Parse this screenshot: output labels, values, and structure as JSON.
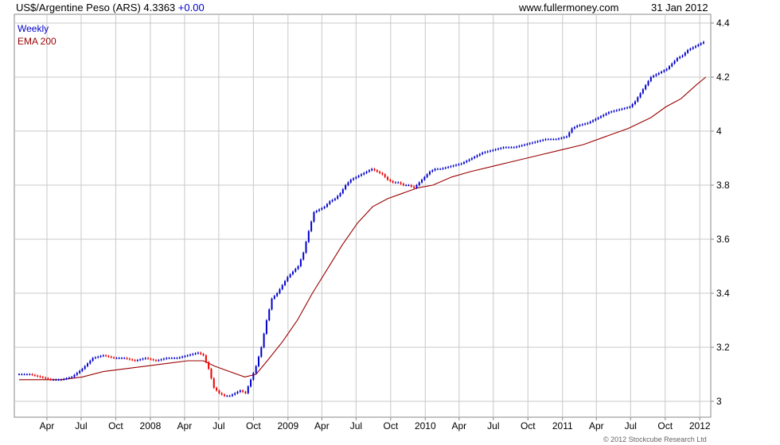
{
  "header": {
    "title": "US$/Argentine Peso (ARS) 4.3363",
    "change": "+0.00",
    "site": "www.fullermoney.com",
    "date": "31 Jan 2012"
  },
  "copyright": "© 2012 Stockcube Research Ltd",
  "colors": {
    "up": "#0000cc",
    "down": "#ee0000",
    "ema": "#990000",
    "grid": "#c8c8c8",
    "frame": "#888888"
  },
  "chart_data": {
    "type": "candlestick-line",
    "frequency": "Weekly",
    "legend": [
      {
        "name": "Weekly",
        "color": "#0000cc"
      },
      {
        "name": "EMA 200",
        "color": "#990000"
      }
    ],
    "legend_position": "top-left",
    "grid": true,
    "ylim": [
      2.95,
      4.42
    ],
    "y_ticks": [
      3,
      3.2,
      3.4,
      3.6,
      3.8,
      4,
      4.2,
      4.4
    ],
    "y_tick_labels": [
      "3",
      "3.2",
      "3.4",
      "3.6",
      "3.8",
      "4",
      "4.2",
      "4.4"
    ],
    "xlim": [
      0,
      1090
    ],
    "x_ticks": [
      {
        "label": "Apr",
        "day": 74
      },
      {
        "label": "Jul",
        "day": 165
      },
      {
        "label": "Oct",
        "day": 257
      },
      {
        "label": "2008",
        "day": 349
      },
      {
        "label": "Apr",
        "day": 440
      },
      {
        "label": "Jul",
        "day": 531
      },
      {
        "label": "Oct",
        "day": 623
      },
      {
        "label": "2009",
        "day": 715
      },
      {
        "label": "Apr",
        "day": 805
      },
      {
        "label": "Jul",
        "day": 896
      },
      {
        "label": "Oct",
        "day": 988
      },
      {
        "label": "2010",
        "day": 1080
      }
    ],
    "x_ticks_late": [
      {
        "label": "Apr",
        "day": 1170
      },
      {
        "label": "Jul",
        "day": 1261
      },
      {
        "label": "Oct",
        "day": 1353
      },
      {
        "label": "2011",
        "day": 1445
      },
      {
        "label": "Apr",
        "day": 1535
      },
      {
        "label": "Jul",
        "day": 1626
      },
      {
        "label": "Oct",
        "day": 1718
      },
      {
        "label": "2012",
        "day": 1810
      }
    ],
    "price_keypoints": [
      [
        0,
        3.1
      ],
      [
        28,
        3.1
      ],
      [
        56,
        3.09
      ],
      [
        84,
        3.08
      ],
      [
        112,
        3.08
      ],
      [
        140,
        3.09
      ],
      [
        168,
        3.12
      ],
      [
        196,
        3.16
      ],
      [
        224,
        3.17
      ],
      [
        252,
        3.16
      ],
      [
        280,
        3.16
      ],
      [
        308,
        3.15
      ],
      [
        336,
        3.16
      ],
      [
        364,
        3.15
      ],
      [
        392,
        3.16
      ],
      [
        420,
        3.16
      ],
      [
        448,
        3.17
      ],
      [
        476,
        3.18
      ],
      [
        490,
        3.17
      ],
      [
        504,
        3.12
      ],
      [
        518,
        3.05
      ],
      [
        532,
        3.03
      ],
      [
        546,
        3.02
      ],
      [
        560,
        3.02
      ],
      [
        574,
        3.03
      ],
      [
        588,
        3.04
      ],
      [
        602,
        3.03
      ],
      [
        616,
        3.08
      ],
      [
        630,
        3.13
      ],
      [
        644,
        3.2
      ],
      [
        658,
        3.3
      ],
      [
        672,
        3.38
      ],
      [
        686,
        3.4
      ],
      [
        700,
        3.43
      ],
      [
        714,
        3.46
      ],
      [
        728,
        3.48
      ],
      [
        742,
        3.5
      ],
      [
        756,
        3.55
      ],
      [
        770,
        3.63
      ],
      [
        784,
        3.7
      ],
      [
        798,
        3.71
      ],
      [
        812,
        3.72
      ],
      [
        826,
        3.74
      ],
      [
        840,
        3.75
      ],
      [
        854,
        3.77
      ],
      [
        868,
        3.8
      ],
      [
        882,
        3.82
      ],
      [
        896,
        3.83
      ],
      [
        910,
        3.84
      ],
      [
        924,
        3.85
      ],
      [
        938,
        3.86
      ],
      [
        952,
        3.85
      ],
      [
        966,
        3.84
      ],
      [
        980,
        3.82
      ],
      [
        994,
        3.81
      ],
      [
        1008,
        3.81
      ],
      [
        1022,
        3.8
      ],
      [
        1036,
        3.8
      ],
      [
        1050,
        3.79
      ],
      [
        1064,
        3.81
      ],
      [
        1078,
        3.83
      ],
      [
        1092,
        3.85
      ],
      [
        1106,
        3.86
      ],
      [
        1120,
        3.86
      ],
      [
        1148,
        3.87
      ],
      [
        1176,
        3.88
      ],
      [
        1204,
        3.9
      ],
      [
        1232,
        3.92
      ],
      [
        1260,
        3.93
      ],
      [
        1288,
        3.94
      ],
      [
        1316,
        3.94
      ],
      [
        1344,
        3.95
      ],
      [
        1372,
        3.96
      ],
      [
        1400,
        3.97
      ],
      [
        1428,
        3.97
      ],
      [
        1456,
        3.98
      ],
      [
        1470,
        4.01
      ],
      [
        1484,
        4.02
      ],
      [
        1512,
        4.03
      ],
      [
        1540,
        4.05
      ],
      [
        1568,
        4.07
      ],
      [
        1596,
        4.08
      ],
      [
        1624,
        4.09
      ],
      [
        1638,
        4.11
      ],
      [
        1652,
        4.14
      ],
      [
        1666,
        4.17
      ],
      [
        1680,
        4.2
      ],
      [
        1694,
        4.21
      ],
      [
        1708,
        4.22
      ],
      [
        1722,
        4.23
      ],
      [
        1736,
        4.25
      ],
      [
        1750,
        4.27
      ],
      [
        1764,
        4.28
      ],
      [
        1778,
        4.3
      ],
      [
        1792,
        4.31
      ],
      [
        1806,
        4.32
      ],
      [
        1820,
        4.33
      ],
      [
        1826,
        4.34
      ]
    ],
    "ema_keypoints": [
      [
        0,
        3.08
      ],
      [
        56,
        3.08
      ],
      [
        112,
        3.08
      ],
      [
        168,
        3.09
      ],
      [
        224,
        3.11
      ],
      [
        280,
        3.12
      ],
      [
        336,
        3.13
      ],
      [
        392,
        3.14
      ],
      [
        448,
        3.15
      ],
      [
        490,
        3.15
      ],
      [
        520,
        3.13
      ],
      [
        560,
        3.11
      ],
      [
        600,
        3.09
      ],
      [
        630,
        3.1
      ],
      [
        660,
        3.15
      ],
      [
        700,
        3.22
      ],
      [
        740,
        3.3
      ],
      [
        780,
        3.4
      ],
      [
        820,
        3.49
      ],
      [
        860,
        3.58
      ],
      [
        900,
        3.66
      ],
      [
        940,
        3.72
      ],
      [
        980,
        3.75
      ],
      [
        1020,
        3.77
      ],
      [
        1060,
        3.79
      ],
      [
        1100,
        3.8
      ],
      [
        1150,
        3.83
      ],
      [
        1200,
        3.85
      ],
      [
        1260,
        3.87
      ],
      [
        1320,
        3.89
      ],
      [
        1380,
        3.91
      ],
      [
        1440,
        3.93
      ],
      [
        1500,
        3.95
      ],
      [
        1560,
        3.98
      ],
      [
        1620,
        4.01
      ],
      [
        1680,
        4.05
      ],
      [
        1720,
        4.09
      ],
      [
        1760,
        4.12
      ],
      [
        1800,
        4.17
      ],
      [
        1826,
        4.2
      ]
    ]
  }
}
